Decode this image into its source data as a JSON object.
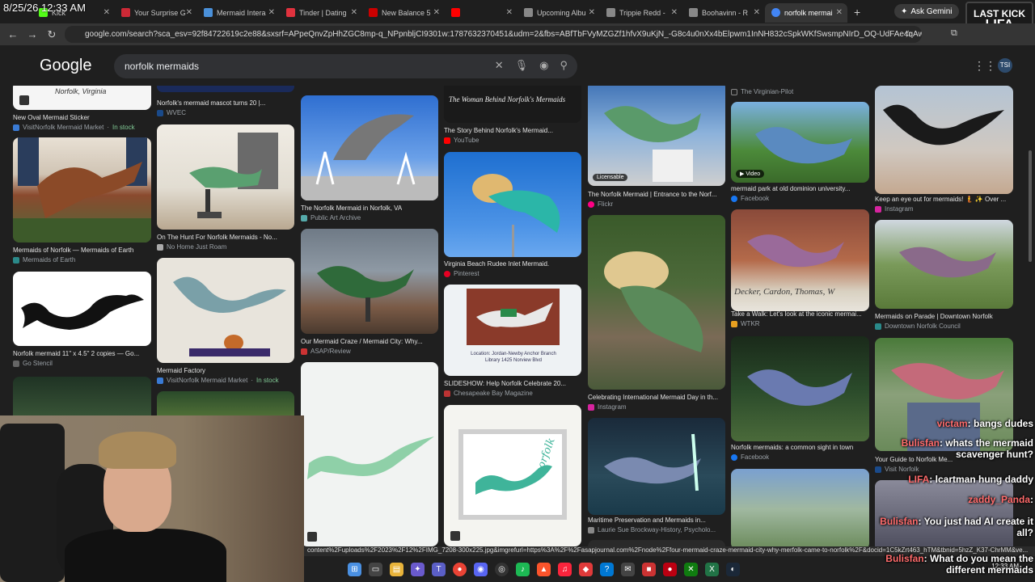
{
  "overlay": {
    "clock": "8/25/26 12:33 AM",
    "kick_line1": "LAST KICK",
    "kick_line2": "LIFA"
  },
  "tabs": [
    {
      "label": "Kick",
      "color": "#53fc18"
    },
    {
      "label": "Your Surprise G",
      "color": "#cc2936"
    },
    {
      "label": "Mermaid Intera",
      "color": "#4a90d9"
    },
    {
      "label": "Tinder | Dating",
      "color": "#e0323e"
    },
    {
      "label": "New Balance 5",
      "color": "#cc0000"
    },
    {
      "label": "",
      "color": "#ff0000"
    },
    {
      "label": "Upcoming Albu",
      "color": "#888888"
    },
    {
      "label": "Trippie Redd -",
      "color": "#888888"
    },
    {
      "label": "Boohavinn - R",
      "color": "#888888"
    },
    {
      "label": "norfolk mermai",
      "color": "#4285f4",
      "active": true
    }
  ],
  "browser": {
    "gemini_label": "Ask Gemini",
    "url": "google.com/search?sca_esv=92f84722619c2e88&sxsrf=APpeQnvZpHhZGC8mp-q_NPpnbljCI9301w:1787632370451&udm=2&fbs=ABfTbFVyMZGZf1hfvX9uKjN_-G8c4u0nXx4bElpwm1InNH832cSpkWKfSwsmpNIrD_OQ-UdFAe4qAwsQWVbrtprjz..."
  },
  "google": {
    "logo": "Google",
    "query": "norfolk mermaids",
    "avatar": "TSI"
  },
  "results": [
    {
      "cap": "New Oval Mermaid Sticker",
      "src": "VisitNorfolk Mermaid Market",
      "stock": "In stock",
      "img_label": "Norfolk, Virginia"
    },
    {
      "cap": "Mermaids of Norfolk — Mermaids of Earth",
      "src": "Mermaids of Earth"
    },
    {
      "cap": "Norfolk mermaid 11\" x 4.5\" 2 copies — Go...",
      "src": "Go Stencil"
    },
    {
      "cap": "Norfolk's mermaid mascot turns 20 |...",
      "src": "WVEC"
    },
    {
      "cap": "On The Hunt For Norfolk Mermaids - No...",
      "src": "No Home Just Roam"
    },
    {
      "cap": "Mermaid Factory",
      "src": "VisitNorfolk Mermaid Market",
      "stock": "In stock"
    },
    {
      "cap": "The Norfolk Mermaid in Norfolk, VA",
      "src": "Public Art Archive"
    },
    {
      "cap": "Our Mermaid Craze / Mermaid City: Why...",
      "src": "ASAP/Review"
    },
    {
      "cap": "The Story Behind Norfolk's Mermaid...",
      "src": "YouTube",
      "img_label": "The Woman Behind Norfolk's Mermaids"
    },
    {
      "cap": "Virginia Beach Rudee Inlet Mermaid.",
      "src": "Pinterest"
    },
    {
      "cap": "SLIDESHOW: Help Norfolk Celebrate 20...",
      "src": "Chesapeake Bay Magazine",
      "img_label": "Location: Jordan-Newby Anchor Branch Library 1425 Norview Blvd"
    },
    {
      "cap": "The Norfolk Mermaid | Entrance to the Norf...",
      "src": "Flickr",
      "badge": "Licensable"
    },
    {
      "cap": "Celebrating International Mermaid Day in th...",
      "src": "Instagram"
    },
    {
      "cap": "Maritime Preservation and Mermaids in...",
      "src": "Laurie Sue Brockway-History, Psycholo..."
    },
    {
      "cap": "mermaid park at old dominion university...",
      "src": "Facebook",
      "badge": "▶ Video",
      "top_src": "The Virginian-Pilot"
    },
    {
      "cap": "Take a Walk: Let's look at the iconic mermai...",
      "src": "WTKR",
      "img_label": "Decker, Cardon, Thomas, W"
    },
    {
      "cap": "Norfolk mermaids: a common sight in town",
      "src": "Facebook"
    },
    {
      "cap": "Keep an eye out for mermaids! 🧜 ✨ Over ...",
      "src": "Instagram"
    },
    {
      "cap": "Mermaids on Parade | Downtown Norfolk",
      "src": "Downtown Norfolk Council"
    },
    {
      "cap": "Your Guide to Norfolk Me...",
      "src": "Visit Norfolk"
    }
  ],
  "mermaid_print_text": "norfolk",
  "status_url": "content%2Fuploads%2F2023%2F12%2FIMG_7208-300x225.jpg&imgrefurl=https%3A%2F%2Fasapjournal.com%2Fnode%2Ffour-mermaid-craze-mermaid-city-why-merfolk-came-to-norfolk%2F&docid=1C5kZrt463_hTM&tbnid=5hzZ_K37-ChrMM&ve...",
  "chat": [
    {
      "user": "victam",
      "text": "bangs dudes"
    },
    {
      "user": "Bulisfan",
      "text": "whats the mermaid scavenger hunt?"
    },
    {
      "user": "LIFA",
      "text": "lcartman hung daddy"
    },
    {
      "user": "zaddy_Panda",
      "text": ""
    },
    {
      "user": "Bulisfan",
      "text": "You just had AI create it all?"
    },
    {
      "user": "Bulisfan",
      "text": "What do you mean the different mermaids"
    }
  ],
  "taskbar": {
    "time": "12:33 AM"
  }
}
